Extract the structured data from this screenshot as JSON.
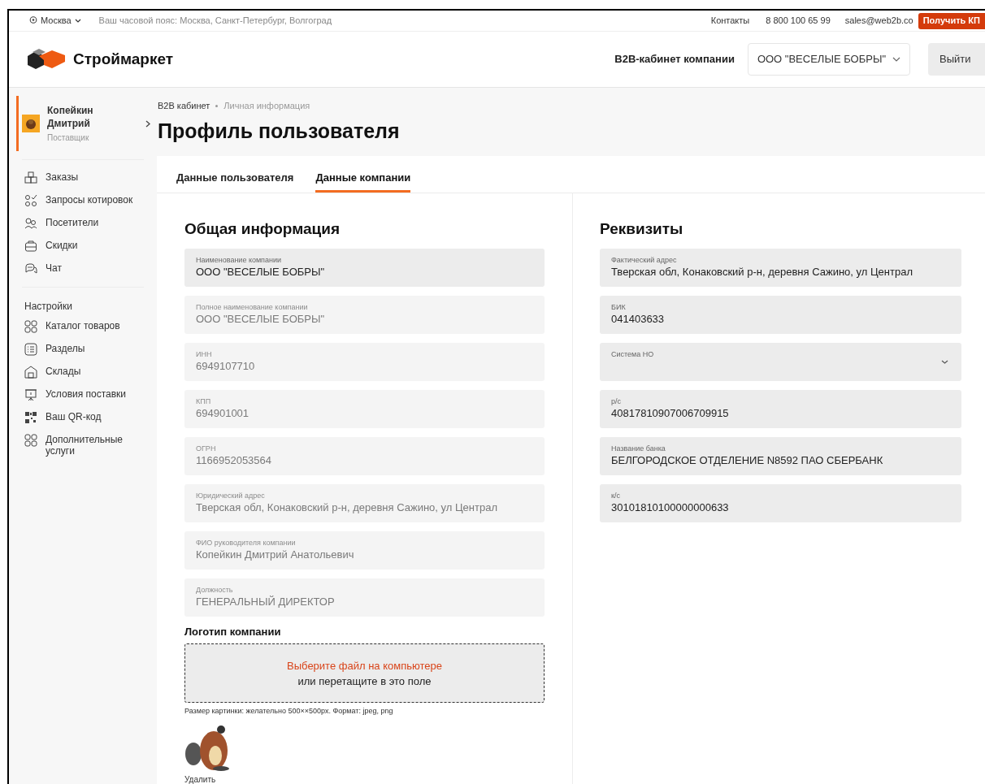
{
  "top_bar": {
    "city": "Москва",
    "timezone": "Ваш часовой пояс: Москва, Санкт-Петербург, Волгоград",
    "contacts": "Контакты",
    "phone": "8 800 100 65 99",
    "email": "sales@web2b.co",
    "cta": "Получить КП"
  },
  "header": {
    "logo_text": "Строймаркет",
    "cabinet_label": "B2B-кабинет компании",
    "company_select": "ООО \"ВЕСЕЛЫЕ БОБРЫ\"",
    "logout": "Выйти"
  },
  "user": {
    "name": "Копейкин Дмитрий",
    "role": "Поставщик"
  },
  "sidebar": {
    "items": [
      {
        "label": "Заказы"
      },
      {
        "label": "Запросы котировок"
      },
      {
        "label": "Посетители"
      },
      {
        "label": "Скидки"
      },
      {
        "label": "Чат"
      }
    ],
    "settings_title": "Настройки",
    "settings_items": [
      {
        "label": "Каталог товаров"
      },
      {
        "label": "Разделы"
      },
      {
        "label": "Склады"
      },
      {
        "label": "Условия поставки"
      },
      {
        "label": "Ваш QR-код"
      },
      {
        "label": "Дополнительные услуги"
      }
    ]
  },
  "breadcrumbs": [
    "B2B кабинет",
    "Личная информация"
  ],
  "page_title": "Профиль пользователя",
  "tabs": [
    {
      "label": "Данные пользователя",
      "selected": false
    },
    {
      "label": "Данные компании",
      "selected": true
    }
  ],
  "sections": [
    {
      "title": "Общая информация",
      "fields": [
        {
          "kind": "input",
          "label": "Наименование компании",
          "value": "ООО \"ВЕСЕЛЫЕ БОБРЫ\"",
          "disabled": false
        },
        {
          "kind": "input",
          "label": "Полное наименование компании",
          "value": "ООО \"ВЕСЕЛЫЕ БОБРЫ\"",
          "disabled": true
        },
        {
          "kind": "input",
          "label": "ИНН",
          "value": "6949107710",
          "disabled": true
        },
        {
          "kind": "input",
          "label": "КПП",
          "value": "694901001",
          "disabled": true
        },
        {
          "kind": "input",
          "label": "ОГРН",
          "value": "1166952053564",
          "disabled": true
        },
        {
          "kind": "input",
          "label": "Юридический адрес",
          "value": "Тверская обл, Конаковский р-н, деревня Сажино, ул Централ",
          "disabled": true
        },
        {
          "kind": "input",
          "label": "ФИО руководителя компании",
          "value": "Копейкин Дмитрий Анатольевич",
          "disabled": true
        },
        {
          "kind": "input",
          "label": "Должность",
          "value": "ГЕНЕРАЛЬНЫЙ ДИРЕКТОР",
          "disabled": true
        }
      ]
    },
    {
      "title": "Реквизиты",
      "fields": [
        {
          "kind": "input",
          "label": "Фактический адрес",
          "value": "Тверская обл, Конаковский р-н, деревня Сажино, ул Централ",
          "disabled": false
        },
        {
          "kind": "input",
          "label": "БИК",
          "value": "041403633",
          "disabled": false
        },
        {
          "kind": "select",
          "label": "Система НО",
          "disabled": false
        },
        {
          "kind": "input",
          "label": "р/с",
          "value": "40817810907006709915",
          "disabled": false
        },
        {
          "kind": "input",
          "label": "Название банка",
          "value": "БЕЛГОРОДСКОЕ ОТДЕЛЕНИЕ N8592 ПАО СБЕРБАНК",
          "disabled": false
        },
        {
          "kind": "input",
          "label": "к/с",
          "value": "30101810100000000633",
          "disabled": false
        }
      ]
    }
  ],
  "logo_upload": {
    "title": "Логотип компании",
    "choose_link": "Выберите файл на компьютере",
    "drop_hint": "или перетащите в это поле",
    "note": "Размер картинки: желательно 500××500px. Формат: jpeg, png",
    "delete": "Удалить"
  }
}
